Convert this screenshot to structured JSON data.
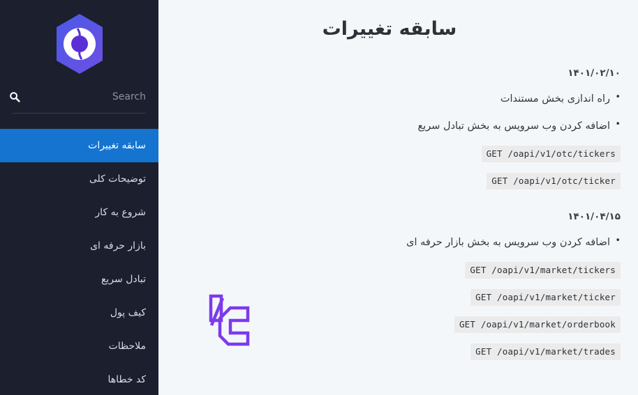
{
  "sidebar": {
    "brand": {
      "logo_icon": "hexagon-brand-logo",
      "colors": {
        "hex_start": "#4a5ae8",
        "hex_end": "#6a52e0",
        "ring": "#ffffff",
        "dot": "#5b2fd6"
      }
    },
    "search": {
      "placeholder": "Search",
      "value": "",
      "icon": "search-icon"
    },
    "items": [
      {
        "label": "سابقه تغییرات",
        "active": true
      },
      {
        "label": "توضیحات کلی",
        "active": false
      },
      {
        "label": "شروع به کار",
        "active": false
      },
      {
        "label": "بازار حرفه ای",
        "active": false
      },
      {
        "label": "تبادل سریع",
        "active": false
      },
      {
        "label": "کیف پول",
        "active": false
      },
      {
        "label": "ملاحظات",
        "active": false
      },
      {
        "label": "کد خطاها",
        "active": false
      }
    ],
    "colors": {
      "background": "#1b1f2e",
      "active": "#1474d0",
      "text": "#d8dce6"
    }
  },
  "main": {
    "title": "سابقه تغییرات",
    "watermark_icon": "bitlc-watermark-logo",
    "watermark_color": "#7c3aed",
    "background": "#f4f7fa",
    "sections": [
      {
        "date": "۱۴۰۱/۰۲/۱۰",
        "entries": [
          {
            "text": "راه اندازی بخش مستندات",
            "endpoints": []
          },
          {
            "text": "اضافه کردن وب سرویس به بخش تبادل سریع",
            "endpoints": [
              "GET /oapi/v1/otc/tickers",
              "GET /oapi/v1/otc/ticker"
            ]
          }
        ]
      },
      {
        "date": "۱۴۰۱/۰۴/۱۵",
        "entries": [
          {
            "text": "اضافه کردن وب سرویس به بخش بازار حرفه ای",
            "endpoints": [
              "GET /oapi/v1/market/tickers",
              "GET /oapi/v1/market/ticker",
              "GET /oapi/v1/market/orderbook",
              "GET /oapi/v1/market/trades"
            ]
          }
        ]
      }
    ]
  }
}
